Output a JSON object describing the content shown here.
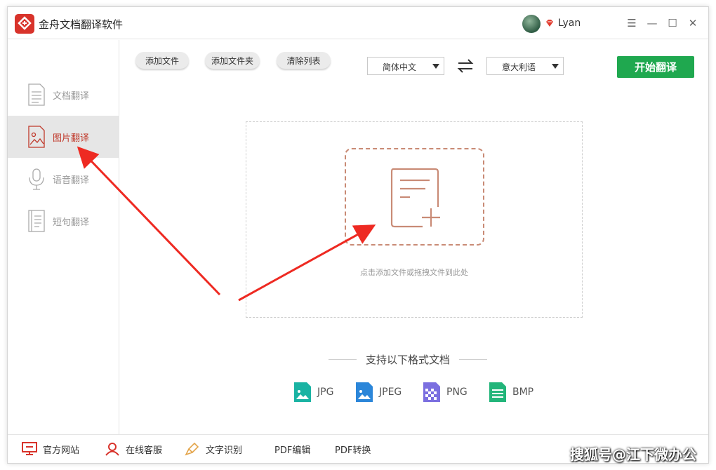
{
  "window": {
    "title": "金舟文档翻译软件"
  },
  "user": {
    "name": "Lyan"
  },
  "window_controls": {
    "menu": "☰",
    "minimize": "—",
    "maximize": "☐",
    "close": "✕"
  },
  "sidebar": {
    "items": [
      {
        "label": "文档翻译",
        "icon": "document-icon",
        "active": false
      },
      {
        "label": "图片翻译",
        "icon": "image-icon",
        "active": true
      },
      {
        "label": "语音翻译",
        "icon": "microphone-icon",
        "active": false
      },
      {
        "label": "短句翻译",
        "icon": "text-lines-icon",
        "active": false
      }
    ]
  },
  "toolbar": {
    "add_file": "添加文件",
    "add_folder": "添加文件夹",
    "clear_list": "清除列表",
    "source_lang": "简体中文",
    "target_lang": "意大利语",
    "start": "开始翻译"
  },
  "dropzone": {
    "hint": "点击添加文件或拖拽文件到此处"
  },
  "formats": {
    "title": "支持以下格式文档",
    "items": [
      {
        "label": "JPG",
        "color": "#1ab3a3"
      },
      {
        "label": "JPEG",
        "color": "#2b86d9"
      },
      {
        "label": "PNG",
        "color": "#7b6fe0"
      },
      {
        "label": "BMP",
        "color": "#22b57a"
      }
    ]
  },
  "footer": {
    "items": [
      "官方网站",
      "在线客服",
      "文字识别",
      "PDF编辑",
      "PDF转换"
    ]
  },
  "watermark": "搜狐号@江下微办公",
  "colors": {
    "accent_red": "#d8332b",
    "start_green": "#1fa84f",
    "arrow_red": "#ee2a22"
  }
}
